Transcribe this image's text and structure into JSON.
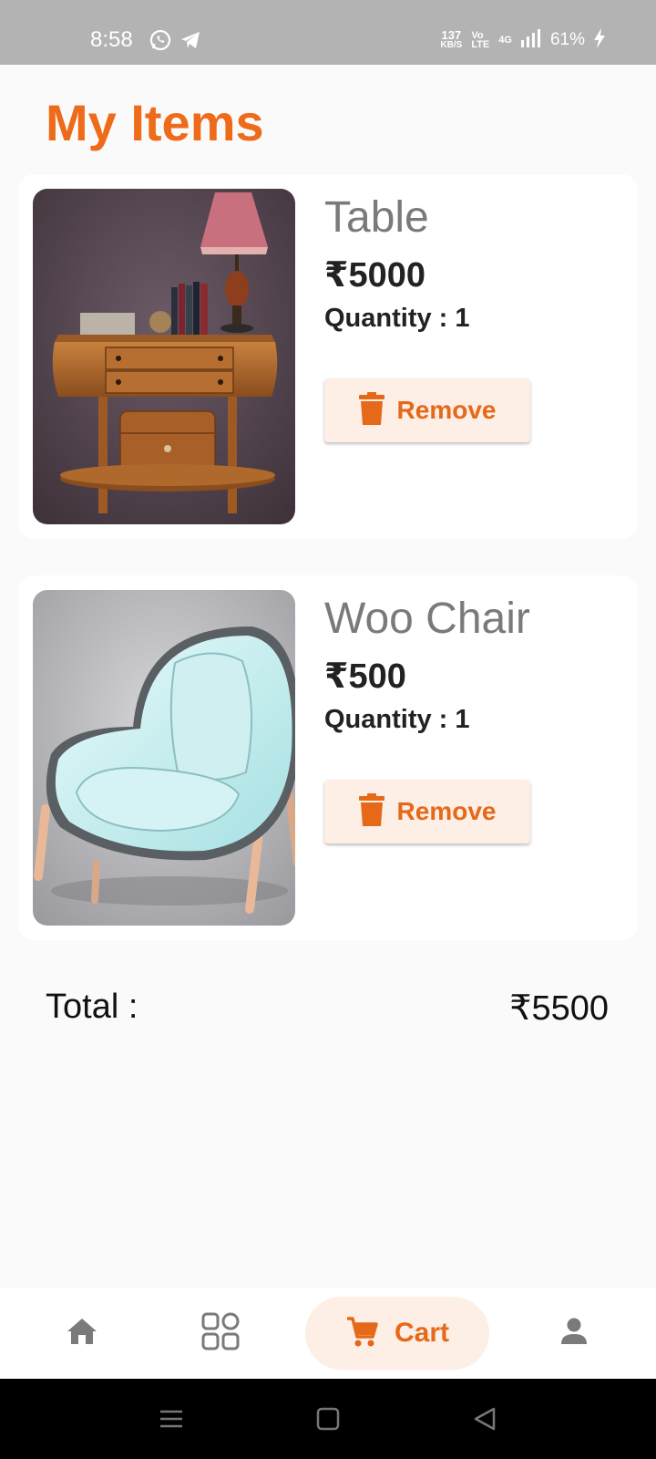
{
  "status_bar": {
    "time": "8:58",
    "net_speed_value": "137",
    "net_speed_unit": "KB/S",
    "volte_top": "Vo",
    "volte_bottom": "LTE",
    "network": "4G",
    "battery": "61%",
    "icons": [
      "whatsapp-icon",
      "telegram-icon",
      "signal-icon",
      "charging-icon"
    ]
  },
  "page": {
    "title": "My Items"
  },
  "items": [
    {
      "name": "Table",
      "price": "₹5000",
      "quantity": "Quantity : 1",
      "remove_label": "Remove",
      "image": "table-image"
    },
    {
      "name": "Woo Chair",
      "price": "₹500",
      "quantity": "Quantity : 1",
      "remove_label": "Remove",
      "image": "chair-image"
    }
  ],
  "summary": {
    "total_label": "Total :",
    "total_value": "₹5500"
  },
  "bottom_nav": {
    "items": [
      {
        "icon": "home-icon"
      },
      {
        "icon": "grid-icon"
      },
      {
        "icon": "cart-icon",
        "label": "Cart",
        "active": true
      },
      {
        "icon": "person-icon"
      }
    ]
  },
  "colors": {
    "accent": "#ee6b1a",
    "accent_light": "#fdeee6",
    "status_bar": "#b3b3b3"
  }
}
